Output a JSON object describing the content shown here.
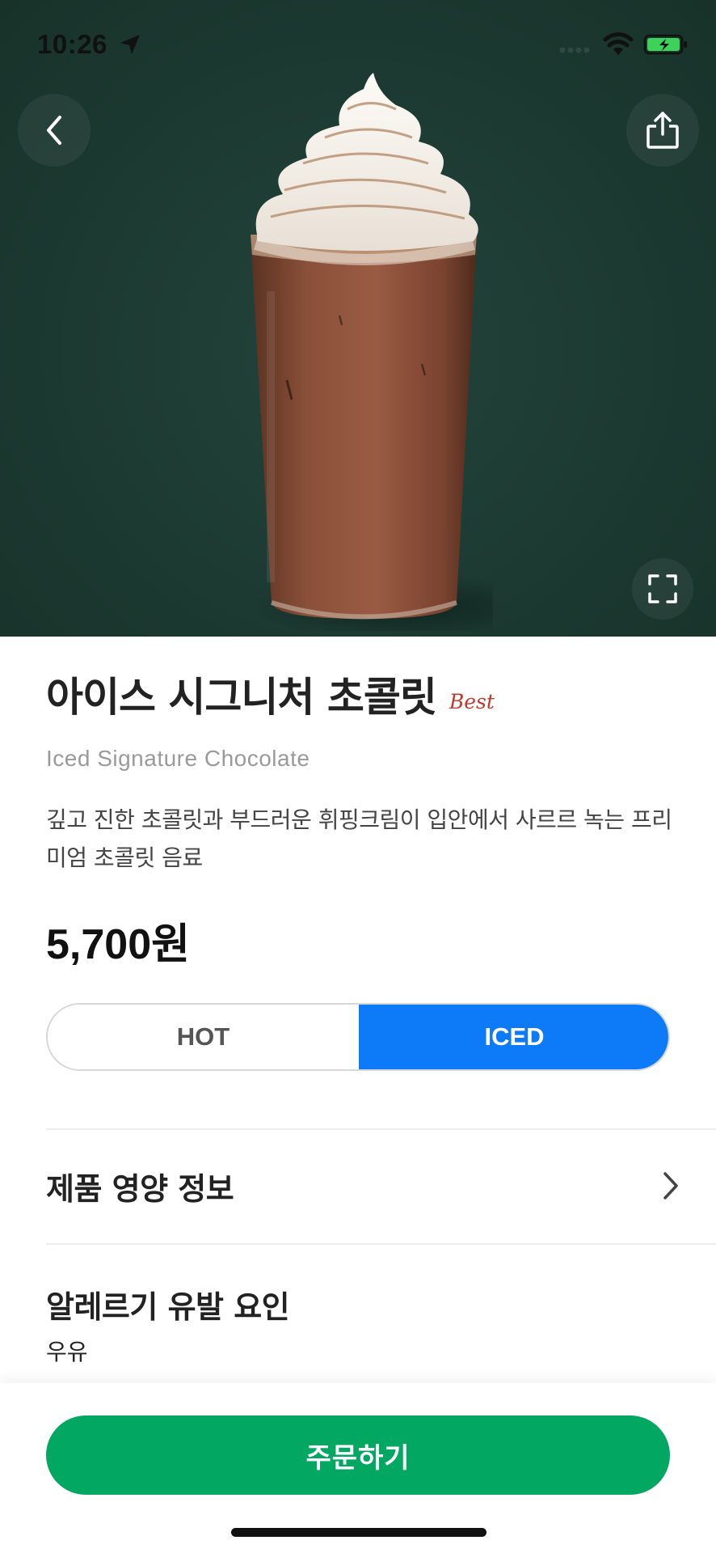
{
  "status_bar": {
    "time": "10:26"
  },
  "product": {
    "name_ko": "아이스 시그니처 초콜릿",
    "badge": "Best",
    "name_en": "Iced Signature Chocolate",
    "description": "깊고 진한 초콜릿과 부드러운 휘핑크림이 입안에서 사르르 녹는 프리미엄 초콜릿 음료",
    "price": "5,700원",
    "image_icon": "iced-chocolate-drink-image"
  },
  "temperature": {
    "options": [
      "HOT",
      "ICED"
    ],
    "selected": "ICED",
    "accent_color": "#0d7bf8"
  },
  "nutrition": {
    "label": "제품 영양 정보"
  },
  "allergy": {
    "label": "알레르기 유발 요인",
    "value": "우유"
  },
  "order_button": {
    "label": "주문하기",
    "color": "#02a862"
  },
  "colors": {
    "hero_bg": "#1c3a32",
    "badge": "#c0392b"
  }
}
